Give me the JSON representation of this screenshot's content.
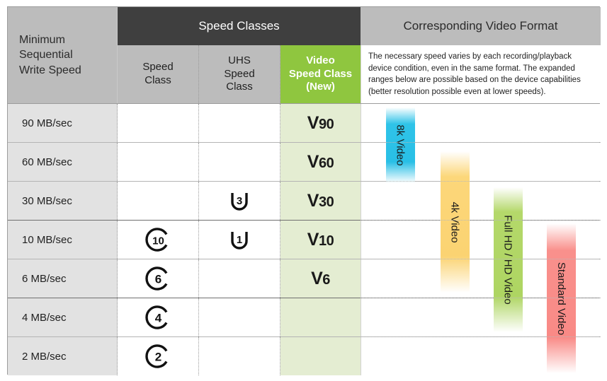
{
  "header": {
    "min_speed_label": "Minimum\nSequential\nWrite Speed",
    "speed_classes_title": "Speed Classes",
    "video_format_title": "Corresponding Video Format",
    "sub_speed_class": "Speed\nClass",
    "sub_uhs_speed_class": "UHS\nSpeed\nClass",
    "sub_video_speed_class": "Video\nSpeed Class\n(New)",
    "description": "The necessary speed varies by each recording/playback device condition, even in the same format. The expanded ranges below are possible based on the device capabilities (better resolution possible even at lower speeds)."
  },
  "colors": {
    "header_dark": "#3f3f3f",
    "header_gray": "#bcbcbc",
    "video_class_green": "#8fc63f",
    "video_cell_green": "#e4edd2",
    "row_label_gray": "#e2e2e2",
    "bar_8k": "#29bfe6",
    "bar_4k": "#fbd372",
    "bar_fullhd": "#aed562",
    "bar_standard": "#f98a86"
  },
  "rows": [
    {
      "speed": "90 MB/sec",
      "speed_class": "",
      "uhs_class": "",
      "video_class": "V90",
      "video_v": "V",
      "video_num": "90"
    },
    {
      "speed": "60 MB/sec",
      "speed_class": "",
      "uhs_class": "",
      "video_class": "V60",
      "video_v": "V",
      "video_num": "60"
    },
    {
      "speed": "30 MB/sec",
      "speed_class": "",
      "uhs_class": "3",
      "video_class": "V30",
      "video_v": "V",
      "video_num": "30"
    },
    {
      "speed": "10 MB/sec",
      "speed_class": "10",
      "uhs_class": "1",
      "video_class": "V10",
      "video_v": "V",
      "video_num": "10"
    },
    {
      "speed": "6 MB/sec",
      "speed_class": "6",
      "uhs_class": "",
      "video_class": "V6",
      "video_v": "V",
      "video_num": "6"
    },
    {
      "speed": "4 MB/sec",
      "speed_class": "4",
      "uhs_class": "",
      "video_class": "",
      "video_v": "",
      "video_num": ""
    },
    {
      "speed": "2 MB/sec",
      "speed_class": "2",
      "uhs_class": "",
      "video_class": "",
      "video_v": "",
      "video_num": ""
    }
  ],
  "video_bars": [
    {
      "label": "8k Video",
      "color": "#29bfe6"
    },
    {
      "label": "4k Video",
      "color": "#fbd372"
    },
    {
      "label": "Full HD / HD Video",
      "color": "#aed562"
    },
    {
      "label": "Standard Video",
      "color": "#f98a86"
    }
  ],
  "chart_data": {
    "type": "table",
    "title": "SD Card Speed Class comparison",
    "columns": [
      "Minimum Sequential Write Speed",
      "Speed Class",
      "UHS Speed Class",
      "Video Speed Class (New)",
      "Corresponding Video Format"
    ],
    "rows": [
      [
        "90 MB/sec",
        "",
        "",
        "V90",
        ""
      ],
      [
        "60 MB/sec",
        "",
        "",
        "V60",
        ""
      ],
      [
        "30 MB/sec",
        "",
        "U3",
        "V30",
        ""
      ],
      [
        "10 MB/sec",
        "C10",
        "U1",
        "V10",
        ""
      ],
      [
        "6 MB/sec",
        "C6",
        "",
        "V6",
        ""
      ],
      [
        "4 MB/sec",
        "C4",
        "",
        "",
        ""
      ],
      [
        "2 MB/sec",
        "C2",
        "",
        "",
        ""
      ]
    ],
    "video_format_ranges": [
      {
        "name": "8k Video",
        "from_mbps": 90,
        "to_mbps": 60
      },
      {
        "name": "4k Video",
        "from_mbps": 60,
        "to_mbps": 10
      },
      {
        "name": "Full HD / HD Video",
        "from_mbps": 30,
        "to_mbps": 6
      },
      {
        "name": "Standard Video",
        "from_mbps": 10,
        "to_mbps": 2
      }
    ],
    "ylabel": "Minimum Sequential Write Speed",
    "ytick_labels": [
      "90 MB/sec",
      "60 MB/sec",
      "30 MB/sec",
      "10 MB/sec",
      "6 MB/sec",
      "4 MB/sec",
      "2 MB/sec"
    ],
    "grid": true,
    "legend": "none"
  }
}
